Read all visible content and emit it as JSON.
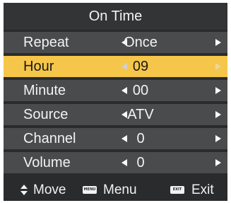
{
  "title": "On Time",
  "rows": [
    {
      "label": "Repeat",
      "value": "Once"
    },
    {
      "label": "Hour",
      "value": "09"
    },
    {
      "label": "Minute",
      "value": "00"
    },
    {
      "label": "Source",
      "value": "ATV"
    },
    {
      "label": "Channel",
      "value": "0"
    },
    {
      "label": "Volume",
      "value": "0"
    }
  ],
  "selected_row": "Hour",
  "footer": {
    "move_label": "Move",
    "menu_key": "MENU",
    "menu_label": "Menu",
    "exit_key": "EXIT",
    "exit_label": "Exit"
  },
  "colors": {
    "background": "#2a2b2d",
    "row": "#4a4b4d",
    "selected": "#f6c64a",
    "text": "#f2f2f2"
  },
  "icons": {
    "left": "left-arrow-icon",
    "right": "right-arrow-icon",
    "move": "up-down-icon",
    "menu": "menu-key-icon",
    "exit": "exit-key-icon"
  }
}
